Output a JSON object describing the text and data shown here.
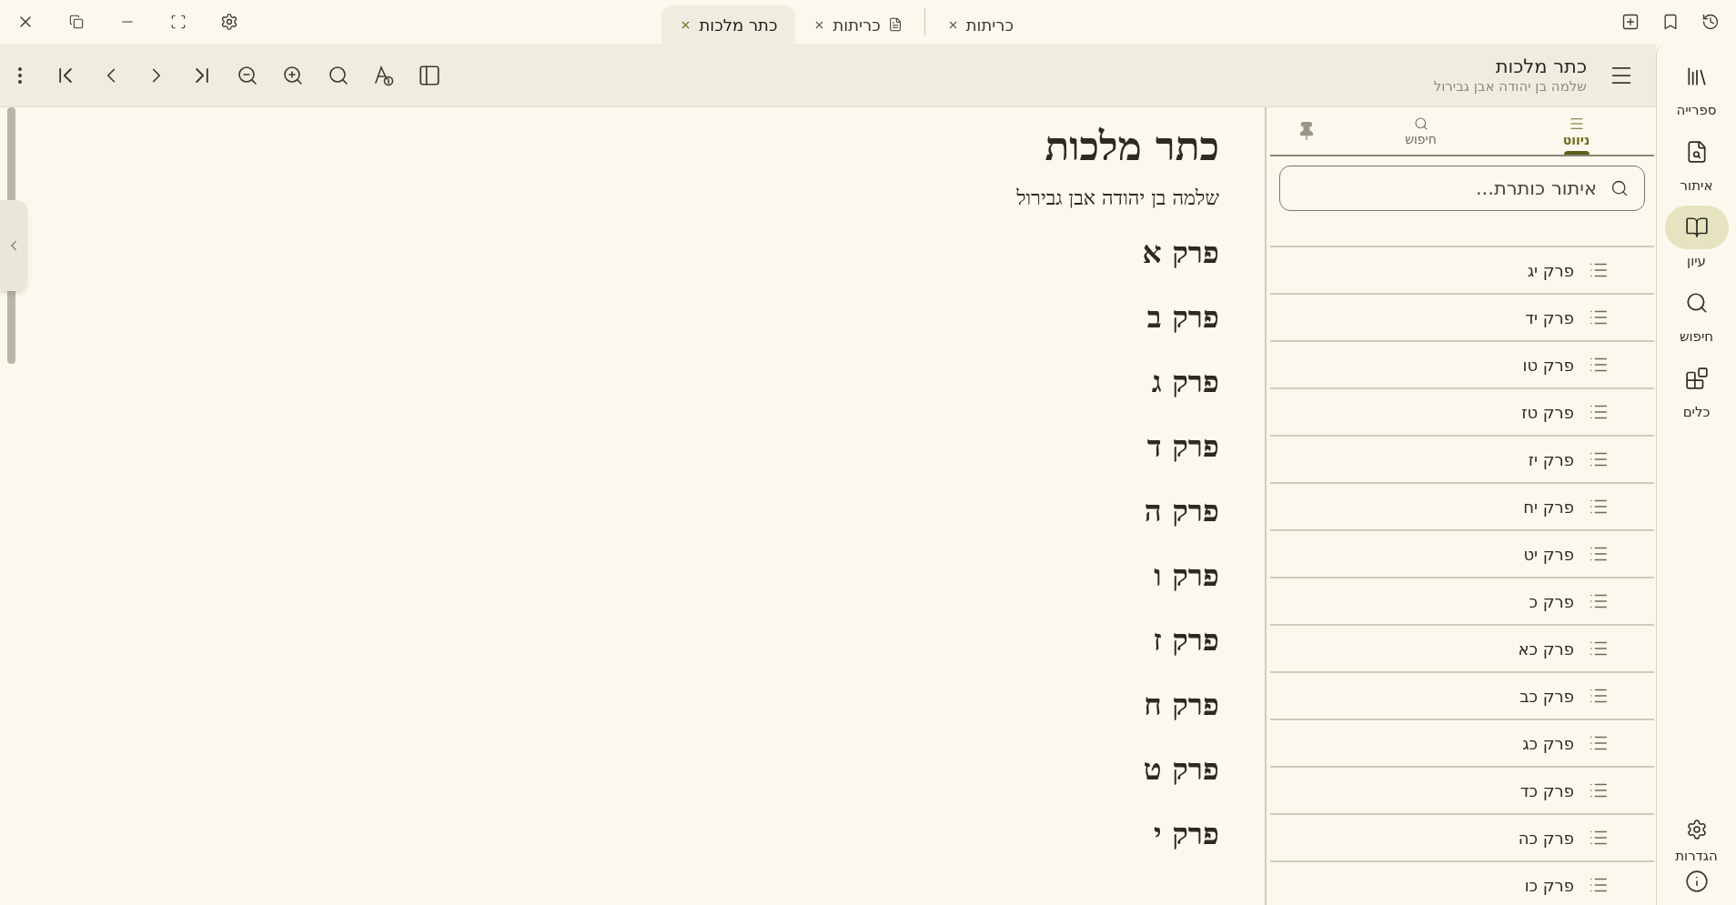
{
  "tabs": [
    {
      "label": "כריתות",
      "selected": false,
      "kind": "text"
    },
    {
      "label": "כריתות",
      "selected": false,
      "kind": "pdf"
    },
    {
      "label": "כתר מלכות",
      "selected": true,
      "kind": "text"
    }
  ],
  "toolbar": {
    "title": "כתר מלכות",
    "subtitle": "שלמה בן יהודה אבן גבירול"
  },
  "sidebar": {
    "items": [
      {
        "label": "ספרייה",
        "selected": false,
        "kind": "library"
      },
      {
        "label": "איתור",
        "selected": false,
        "kind": "find"
      },
      {
        "label": "עיון",
        "selected": true,
        "kind": "read"
      },
      {
        "label": "חיפוש",
        "selected": false,
        "kind": "search"
      },
      {
        "label": "כלים",
        "selected": false,
        "kind": "tools"
      }
    ],
    "settings_label": "הגדרות"
  },
  "toc": {
    "tabs": [
      {
        "label": "ניווט",
        "selected": true,
        "kind": "nav"
      },
      {
        "label": "חיפוש",
        "selected": false,
        "kind": "search"
      }
    ],
    "search": {
      "placeholder": "איתור כותרת..."
    },
    "items": [
      "פרק יג",
      "פרק יד",
      "פרק טו",
      "פרק טז",
      "פרק יז",
      "פרק יח",
      "פרק יט",
      "פרק כ",
      "פרק כא",
      "פרק כב",
      "פרק כג",
      "פרק כד",
      "פרק כה",
      "פרק כו"
    ]
  },
  "document": {
    "title": "כתר מלכות",
    "author": "שלמה בן יהודה אבן גבירול",
    "headings": [
      "פרק א",
      "פרק ב",
      "פרק ג",
      "פרק ד",
      "פרק ה",
      "פרק ו",
      "פרק ז",
      "פרק ח",
      "פרק ט",
      "פרק י"
    ]
  }
}
